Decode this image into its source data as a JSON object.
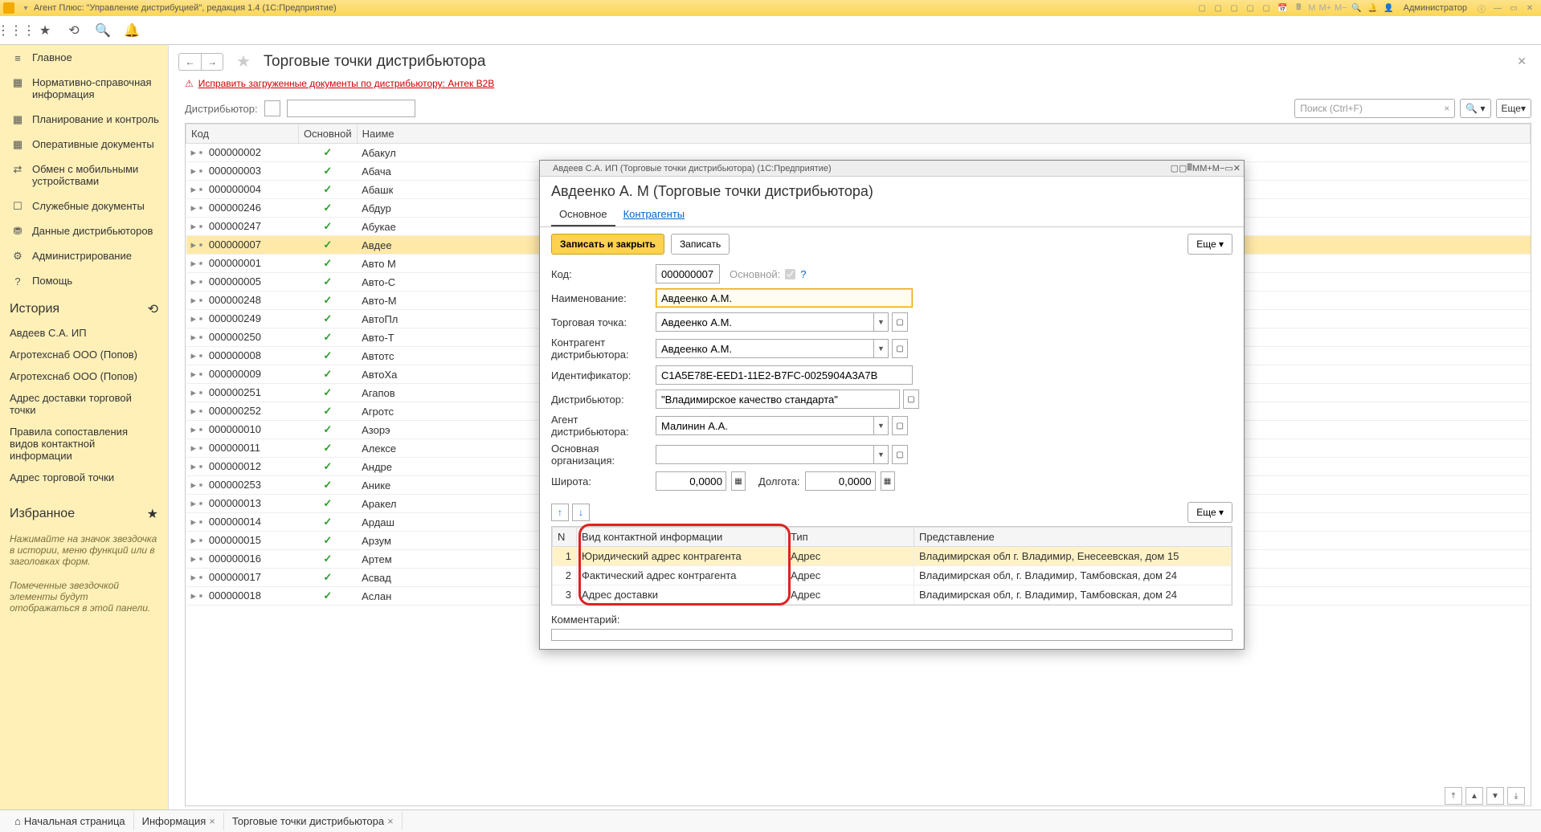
{
  "titlebar": {
    "title": "Агент Плюс: \"Управление дистрибуцией\", редакция 1.4  (1С:Предприятие)",
    "m_labels": [
      "M",
      "M+",
      "M−"
    ],
    "admin": "Администратор"
  },
  "sidebar": {
    "items": [
      {
        "icon": "≡",
        "label": "Главное"
      },
      {
        "icon": "▦",
        "label": "Нормативно-справочная информация"
      },
      {
        "icon": "▦",
        "label": "Планирование и контроль"
      },
      {
        "icon": "▦",
        "label": "Оперативные документы"
      },
      {
        "icon": "⇄",
        "label": "Обмен с мобильными устройствами"
      },
      {
        "icon": "☐",
        "label": "Служебные документы"
      },
      {
        "icon": "⛃",
        "label": "Данные дистрибьюторов"
      },
      {
        "icon": "⚙",
        "label": "Администрирование"
      },
      {
        "icon": "?",
        "label": "Помощь"
      }
    ],
    "history_title": "История",
    "history": [
      "Авдеев С.А. ИП",
      "Агротехснаб ООО (Попов)",
      "Агротехснаб ООО (Попов)",
      "Адрес доставки торговой точки",
      "Правила сопоставления видов контактной информации",
      "Адрес торговой точки"
    ],
    "favorites_title": "Избранное",
    "fav_hint1": "Нажимайте на значок звездочка в истории, меню функций или в заголовках форм.",
    "fav_hint2": "Помеченные звездочкой элементы будут отображаться в этой панели."
  },
  "page": {
    "title": "Торговые точки дистрибьютора",
    "warn_link": "Исправить загруженные документы по дистрибьютору: Антек В2В",
    "filter_label": "Дистрибьютор:",
    "search_placeholder": "Поиск (Ctrl+F)",
    "more_label": "Еще",
    "columns": [
      "Код",
      "Основной",
      "Наиме"
    ],
    "rows": [
      {
        "code": "000000002",
        "name": "Абакул"
      },
      {
        "code": "000000003",
        "name": "Абача"
      },
      {
        "code": "000000004",
        "name": "Абашк"
      },
      {
        "code": "000000246",
        "name": "Абдур"
      },
      {
        "code": "000000247",
        "name": "Абукае"
      },
      {
        "code": "000000007",
        "name": "Авдее",
        "selected": true
      },
      {
        "code": "000000001",
        "name": "Авто М"
      },
      {
        "code": "000000005",
        "name": "Авто-С"
      },
      {
        "code": "000000248",
        "name": "Авто-М"
      },
      {
        "code": "000000249",
        "name": "АвтоПл"
      },
      {
        "code": "000000250",
        "name": "Авто-Т"
      },
      {
        "code": "000000008",
        "name": "Автотс"
      },
      {
        "code": "000000009",
        "name": "АвтоХа"
      },
      {
        "code": "000000251",
        "name": "Агапов"
      },
      {
        "code": "000000252",
        "name": "Агротс"
      },
      {
        "code": "000000010",
        "name": "Азорэ"
      },
      {
        "code": "000000011",
        "name": "Алексе"
      },
      {
        "code": "000000012",
        "name": "Андре"
      },
      {
        "code": "000000253",
        "name": "Анике"
      },
      {
        "code": "000000013",
        "name": "Аракел"
      },
      {
        "code": "000000014",
        "name": "Ардаш"
      },
      {
        "code": "000000015",
        "name": "Арзум"
      },
      {
        "code": "000000016",
        "name": "Артем"
      },
      {
        "code": "000000017",
        "name": "Асвад"
      },
      {
        "code": "000000018",
        "name": "Аслан"
      }
    ]
  },
  "bottomTabs": [
    {
      "label": "Начальная страница",
      "closable": false,
      "icon": "⌂"
    },
    {
      "label": "Информация",
      "closable": true
    },
    {
      "label": "Торговые точки дистрибьютора",
      "closable": true
    }
  ],
  "dialog": {
    "window_title": "Авдеев С.А. ИП (Торговые точки дистрибьютора)  (1С:Предприятие)",
    "title": "Авдеенко А. М  (Торговые точки дистрибьютора)",
    "tabs": [
      "Основное",
      "Контрагенты"
    ],
    "btn_save_close": "Записать и закрыть",
    "btn_save": "Записать",
    "btn_more": "Еще",
    "fields": {
      "code_label": "Код:",
      "code": "000000007",
      "main_label": "Основной:",
      "main_checked": true,
      "name_label": "Наименование:",
      "name": "Авдеенко А.М.",
      "tp_label": "Торговая точка:",
      "tp": "Авдеенко А.М.",
      "contr_label": "Контрагент дистрибьютора:",
      "contr": "Авдеенко А.М.",
      "id_label": "Идентификатор:",
      "id": "C1A5E78E-EED1-11E2-B7FC-0025904A3A7B",
      "dist_label": "Дистрибьютор:",
      "dist": "\"Владимирское качество стандарта\"",
      "agent_label": "Агент дистрибьютора:",
      "agent": "Малинин А.А.",
      "org_label": "Основная организация:",
      "org": "",
      "lat_label": "Широта:",
      "lat": "0,0000",
      "lon_label": "Долгота:",
      "lon": "0,0000"
    },
    "grid": {
      "cols": [
        "N",
        "Вид контактной информации",
        "Тип",
        "Представление"
      ],
      "rows": [
        {
          "n": "1",
          "kind": "Юридический адрес контрагента",
          "type": "Адрес",
          "repr": "Владимирская обл г. Владимир, Енесеевская, дом 15",
          "sel": true
        },
        {
          "n": "2",
          "kind": "Фактический адрес контрагента",
          "type": "Адрес",
          "repr": "Владимирская обл, г. Владимир, Тамбовская, дом 24"
        },
        {
          "n": "3",
          "kind": "Адрес доставки",
          "type": "Адрес",
          "repr": "Владимирская обл, г. Владимир, Тамбовская, дом 24"
        }
      ]
    },
    "comment_label": "Комментарий:"
  }
}
